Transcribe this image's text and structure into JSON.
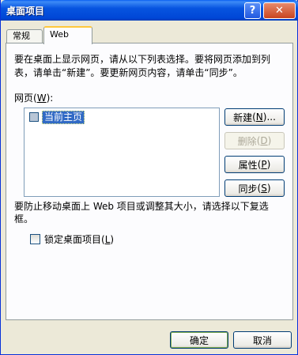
{
  "window": {
    "title": "桌面项目",
    "help_glyph": "?",
    "close_glyph": "✕"
  },
  "tabs": [
    {
      "label": "常规"
    },
    {
      "label": "Web"
    }
  ],
  "description": "要在桌面上显示网页，请从以下列表选择。要将网页添加到列表，请单击“新建”。要更新网页内容，请单击“同步”。",
  "webpages": {
    "label": "网页",
    "shortcut": "W",
    "items": [
      {
        "label": "当前主页",
        "checked": false
      }
    ]
  },
  "buttons": {
    "new": {
      "label": "新建",
      "shortcut": "N",
      "suffix": "..."
    },
    "delete": {
      "label": "删除",
      "shortcut": "D"
    },
    "properties": {
      "label": "属性",
      "shortcut": "P"
    },
    "sync": {
      "label": "同步",
      "shortcut": "S"
    }
  },
  "hint": "要防止移动桌面上 Web 项目或调整其大小，请选择以下复选框。",
  "lock": {
    "label": "锁定桌面项目",
    "shortcut": "L",
    "checked": false
  },
  "footer": {
    "ok": "确定",
    "cancel": "取消"
  }
}
